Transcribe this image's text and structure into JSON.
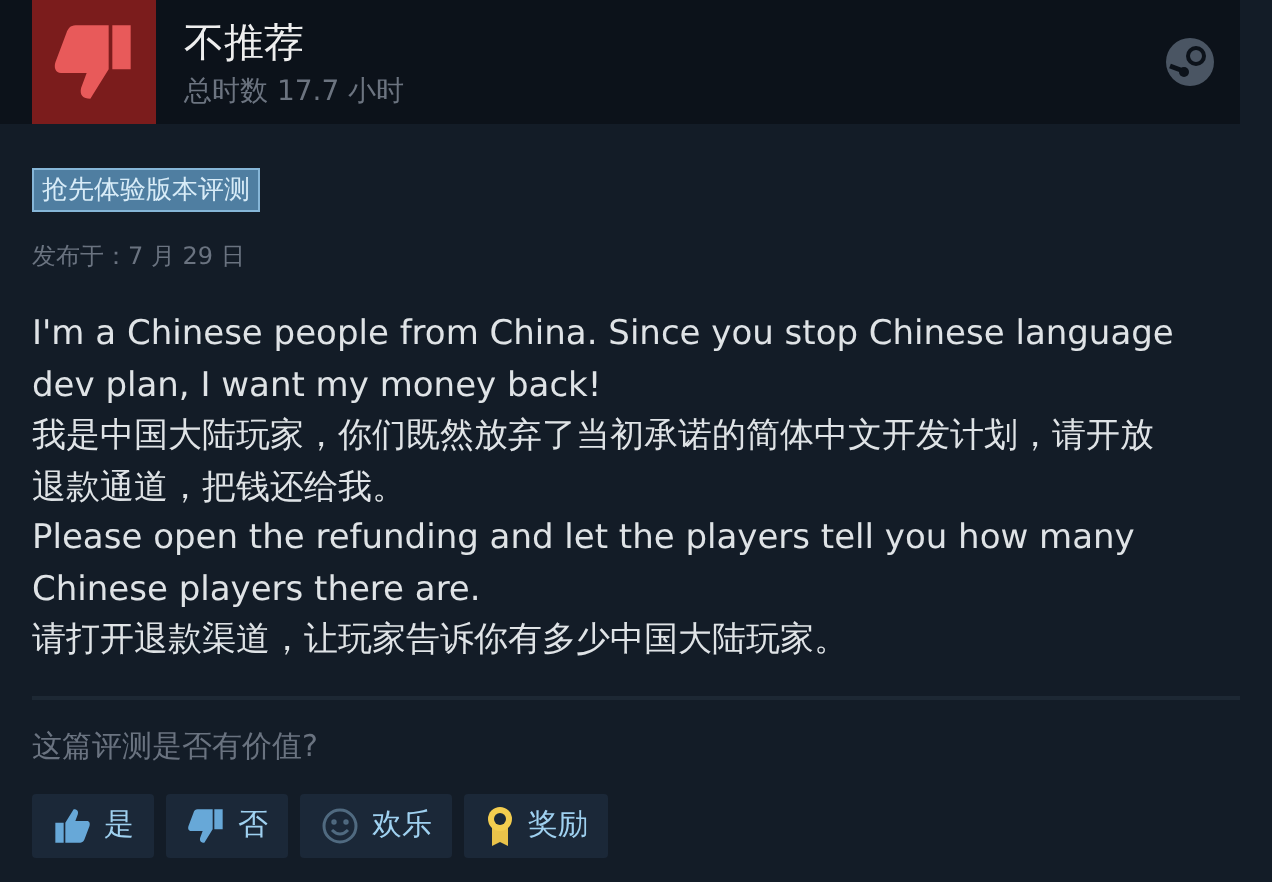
{
  "header": {
    "verdict": "不推荐",
    "recommended": false,
    "playtime": "总时数 17.7 小时"
  },
  "badge": "抢先体验版本评测",
  "posted": "发布于：7 月 29 日",
  "body": [
    "I'm a Chinese people from China. Since you stop Chinese language dev plan, I want my money back!",
    "我是中国大陆玩家，你们既然放弃了当初承诺的简体中文开发计划，请开放退款通道，把钱还给我。",
    "Please open the refunding and let the players tell you how many Chinese players there are.",
    "请打开退款渠道，让玩家告诉你有多少中国大陆玩家。"
  ],
  "helpful": {
    "question": "这篇评测是否有价值?",
    "buttons": [
      {
        "kind": "yes",
        "label": "是"
      },
      {
        "kind": "no",
        "label": "否"
      },
      {
        "kind": "funny",
        "label": "欢乐"
      },
      {
        "kind": "award",
        "label": "奖励"
      }
    ]
  }
}
